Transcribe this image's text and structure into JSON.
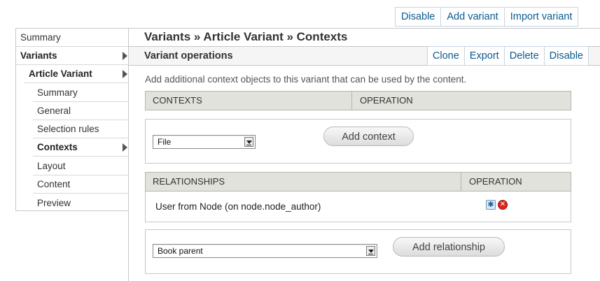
{
  "top_links": [
    "Disable",
    "Add variant",
    "Import variant"
  ],
  "sidebar": {
    "items": [
      {
        "label": "Summary"
      },
      {
        "label": "Variants"
      },
      {
        "label": "Article Variant"
      },
      {
        "label": "Summary"
      },
      {
        "label": "General"
      },
      {
        "label": "Selection rules"
      },
      {
        "label": "Contexts"
      },
      {
        "label": "Layout"
      },
      {
        "label": "Content"
      },
      {
        "label": "Preview"
      }
    ]
  },
  "main": {
    "title": "Variants » Article Variant » Contexts",
    "ops_title": "Variant operations",
    "ops_links": [
      "Clone",
      "Export",
      "Delete",
      "Disable"
    ],
    "description": "Add additional context objects to this variant that can be used by the content.",
    "contexts": {
      "headers": [
        "CONTEXTS",
        "OPERATION"
      ],
      "select_value": "File",
      "add_button": "Add context"
    },
    "relationships": {
      "headers": [
        "RELATIONSHIPS",
        "OPERATION"
      ],
      "rows": [
        {
          "label": "User from Node (on node.node_author)",
          "icons": [
            "gear-icon",
            "delete-icon"
          ]
        }
      ],
      "select_value": "Book parent",
      "add_button": "Add relationship"
    }
  },
  "colors": {
    "link": "#0b5a8e",
    "table_header_bg": "#e1e2dc",
    "ops_bar_bg": "#f5f5f5"
  }
}
